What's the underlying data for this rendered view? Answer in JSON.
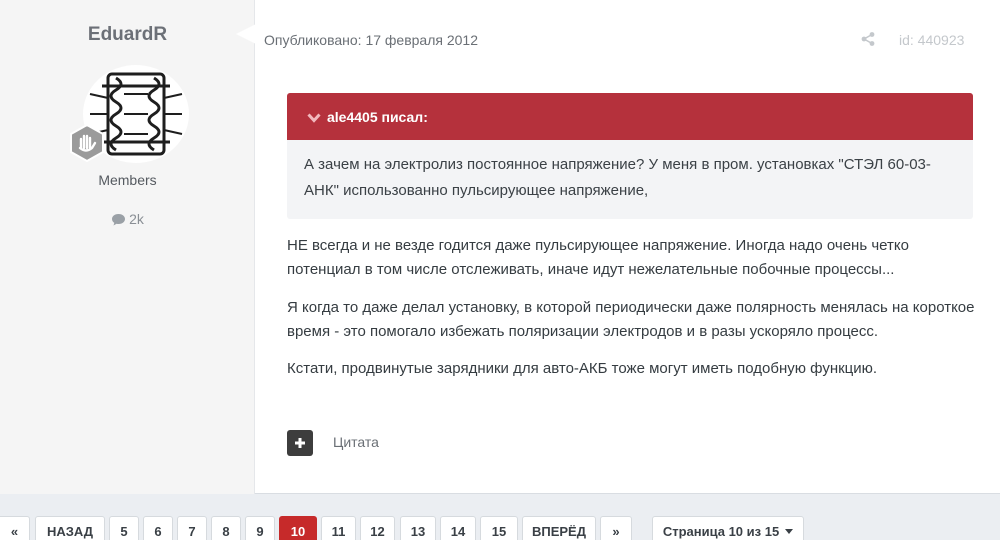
{
  "author": {
    "name": "EduardR",
    "group": "Members",
    "reputation": "2k"
  },
  "post": {
    "published": "Опубликовано: 17 февраля 2012",
    "id": "id: 440923",
    "quote": {
      "author": "ale4405 писал:",
      "text": "А зачем на электролиз постоянное напряжение? У меня в пром. установках \"СТЭЛ 60-03-АНК\" использованно пульсирующее напряжение,"
    },
    "paragraphs": [
      "НЕ всегда и не везде годится даже пульсирующее напряжение. Иногда надо очень четко потенциал в том числе отслеживать, иначе идут нежелательные побочные процессы...",
      "Я когда то даже делал установку, в которой периодически даже полярность менялась на короткое время - это помогало избежать поляризации электродов и в разы ускоряло процесс.",
      "Кстати, продвинутые зарядники для авто-АКБ тоже могут иметь подобную функцию."
    ],
    "quote_button": "Цитата"
  },
  "pagination": {
    "first": "«",
    "prev": "НАЗАД",
    "pages": [
      "5",
      "6",
      "7",
      "8",
      "9",
      "10",
      "11",
      "12",
      "13",
      "14",
      "15"
    ],
    "current": "10",
    "next": "ВПЕРЁД",
    "last": "»",
    "jump": "Страница 10 из 15"
  },
  "colors": {
    "accent": "#c62a2a",
    "quote_header": "#b5313c"
  }
}
